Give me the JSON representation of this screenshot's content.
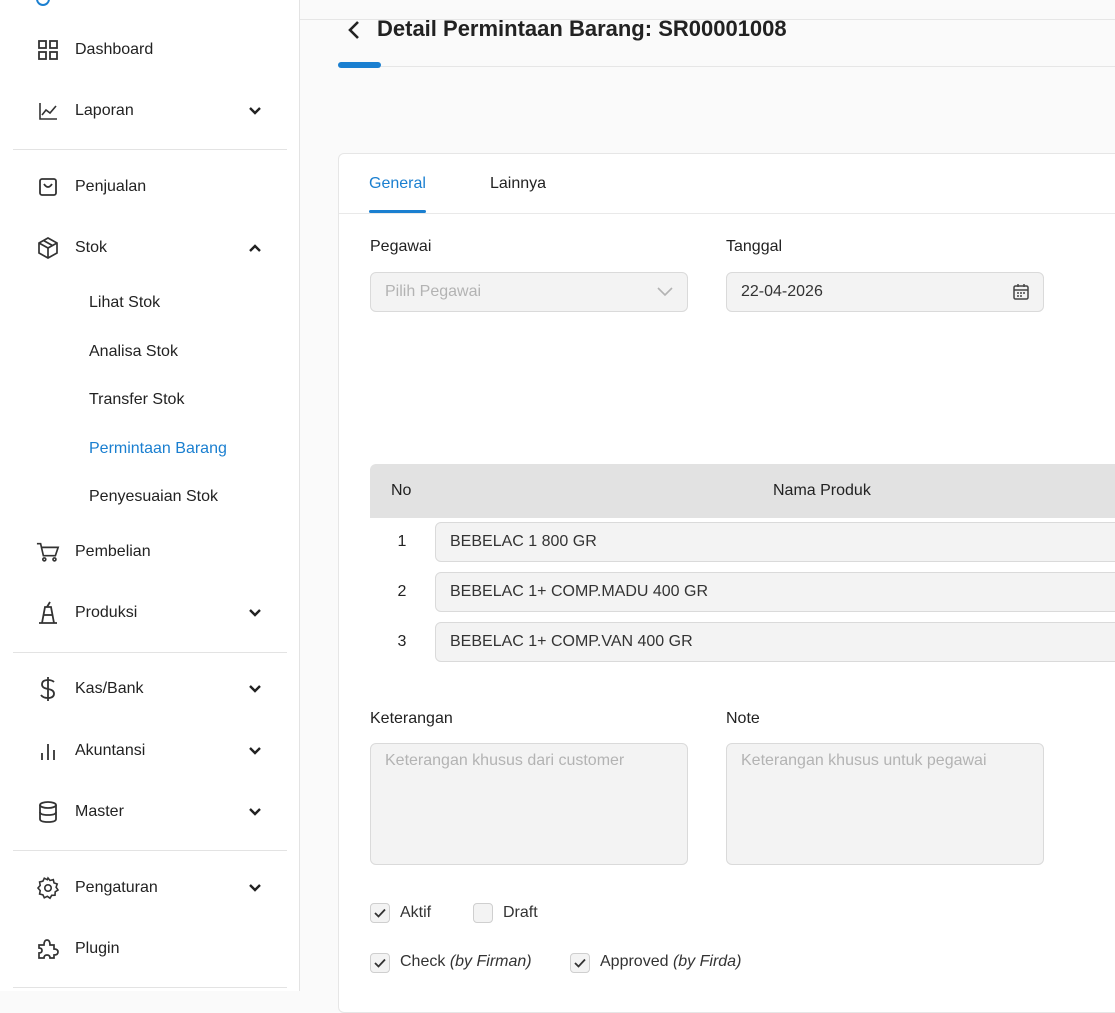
{
  "sidebar": {
    "items": [
      {
        "label": "Dashboard",
        "icon": "grid-icon"
      },
      {
        "label": "Laporan",
        "icon": "line-chart-icon"
      },
      {
        "label": "Penjualan",
        "icon": "shopping-bag-icon"
      },
      {
        "label": "Stok",
        "icon": "box-icon"
      },
      {
        "label": "Pembelian",
        "icon": "cart-icon"
      },
      {
        "label": "Produksi",
        "icon": "factory-icon"
      },
      {
        "label": "Kas/Bank",
        "icon": "dollar-icon"
      },
      {
        "label": "Akuntansi",
        "icon": "bar-chart-icon"
      },
      {
        "label": "Master",
        "icon": "database-icon"
      },
      {
        "label": "Pengaturan",
        "icon": "gear-icon"
      },
      {
        "label": "Plugin",
        "icon": "puzzle-icon"
      }
    ],
    "stok_sub": [
      "Lihat Stok",
      "Analisa Stok",
      "Transfer Stok",
      "Permintaan Barang",
      "Penyesuaian Stok"
    ],
    "active_sub": "Permintaan Barang"
  },
  "header": {
    "title": "Detail Permintaan Barang: SR00001008"
  },
  "tabs": [
    {
      "label": "General",
      "active": true
    },
    {
      "label": "Lainnya",
      "active": false
    }
  ],
  "form": {
    "pegawai_label": "Pegawai",
    "pegawai_placeholder": "Pilih Pegawai",
    "tanggal_label": "Tanggal",
    "tanggal_value": "22-04-2026"
  },
  "table": {
    "headers": [
      "No",
      "Nama Produk"
    ],
    "rows": [
      {
        "no": "1",
        "produk": "BEBELAC 1 800 GR"
      },
      {
        "no": "2",
        "produk": "BEBELAC 1+ COMP.MADU 400 GR"
      },
      {
        "no": "3",
        "produk": "BEBELAC 1+ COMP.VAN 400 GR"
      }
    ]
  },
  "notes": {
    "keterangan_label": "Keterangan",
    "keterangan_placeholder": "Keterangan khusus dari customer",
    "note_label": "Note",
    "note_placeholder": "Keterangan khusus untuk pegawai"
  },
  "checkboxes": {
    "aktif": {
      "label": "Aktif",
      "checked": true
    },
    "draft": {
      "label": "Draft",
      "checked": false
    },
    "check": {
      "label": "Check",
      "by": "(by Firman)",
      "checked": true
    },
    "approved": {
      "label": "Approved",
      "by": "(by Firda)",
      "checked": true
    }
  },
  "colors": {
    "accent": "#1a7fd0"
  }
}
